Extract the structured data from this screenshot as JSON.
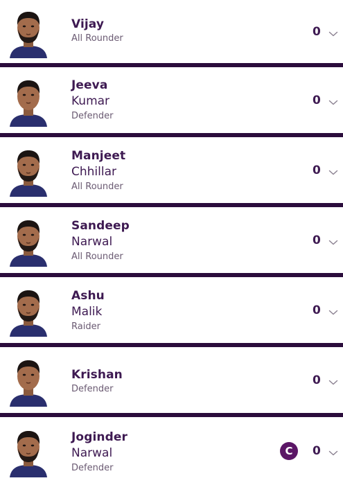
{
  "players": [
    {
      "first_name": "Vijay",
      "last_name": "",
      "role": "All Rounder",
      "points": "0",
      "captain": false,
      "beard": true
    },
    {
      "first_name": "Jeeva",
      "last_name": "Kumar",
      "role": "Defender",
      "points": "0",
      "captain": false,
      "beard": false
    },
    {
      "first_name": "Manjeet",
      "last_name": "Chhillar",
      "role": "All Rounder",
      "points": "0",
      "captain": false,
      "beard": true
    },
    {
      "first_name": "Sandeep",
      "last_name": "Narwal",
      "role": "All Rounder",
      "points": "0",
      "captain": false,
      "beard": true
    },
    {
      "first_name": "Ashu",
      "last_name": "Malik",
      "role": "Raider",
      "points": "0",
      "captain": false,
      "beard": true
    },
    {
      "first_name": "Krishan",
      "last_name": "",
      "role": "Defender",
      "points": "0",
      "captain": false,
      "beard": false
    },
    {
      "first_name": "Joginder",
      "last_name": "Narwal",
      "role": "Defender",
      "points": "0",
      "captain": true,
      "captain_label": "C",
      "beard": true
    }
  ],
  "colors": {
    "divider": "#2b0c3c",
    "name_text": "#3e1a52",
    "role_text": "#6a5a72",
    "captain_badge": "#5b1666",
    "jersey": "#2a2f6e"
  },
  "icons": {
    "expand": "chevron-down-icon",
    "avatar": "player-photo"
  }
}
